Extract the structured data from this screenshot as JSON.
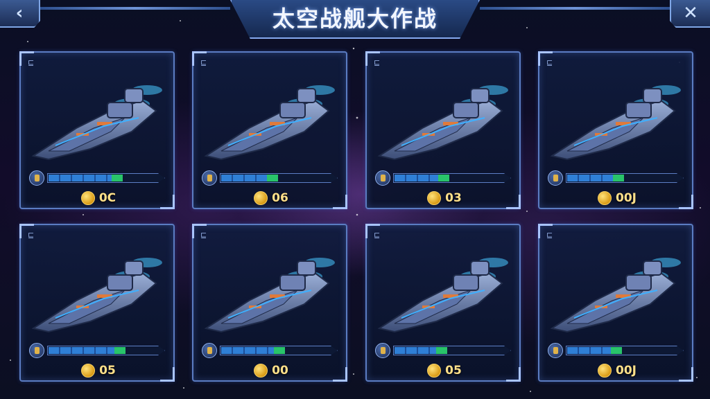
{
  "header": {
    "title": "太空战舰大作战",
    "back_icon": "chevron-left-icon",
    "close_icon": "close-icon"
  },
  "colors": {
    "frame": "#5b7cc2",
    "bar_blue": "#2f7fd6",
    "bar_green": "#29c46a",
    "coin": "#e0a820"
  },
  "ships": [
    {
      "tag": "⊑",
      "level": 0.68,
      "cost": "0C"
    },
    {
      "tag": "⊑",
      "level": 0.52,
      "cost": "06"
    },
    {
      "tag": "⊑",
      "level": 0.5,
      "cost": "03"
    },
    {
      "tag": "⊑",
      "level": 0.52,
      "cost": "00J"
    },
    {
      "tag": "⊑",
      "level": 0.7,
      "cost": "05"
    },
    {
      "tag": "⊑",
      "level": 0.58,
      "cost": "00"
    },
    {
      "tag": "⊑",
      "level": 0.48,
      "cost": "05"
    },
    {
      "tag": "⊑",
      "level": 0.5,
      "cost": "00J"
    }
  ]
}
